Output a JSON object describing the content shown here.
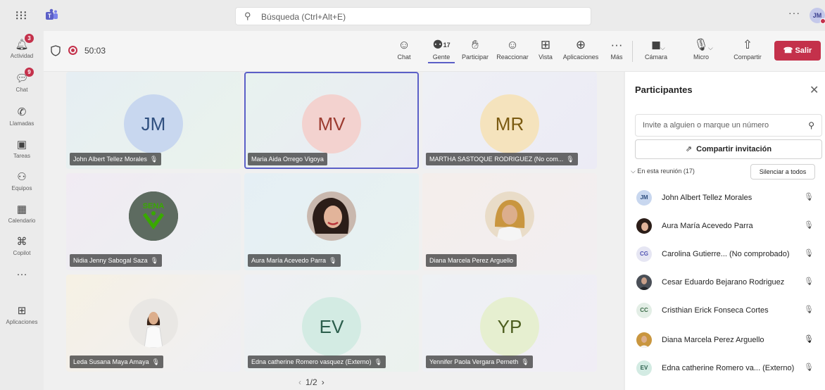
{
  "titlebar": {
    "search_placeholder": "Búsqueda (Ctrl+Alt+E)",
    "more": "···",
    "user_initials": "JM"
  },
  "rail": {
    "items": [
      {
        "label": "Actividad",
        "badge": "3"
      },
      {
        "label": "Chat",
        "badge": "9"
      },
      {
        "label": "Llamadas",
        "badge": ""
      },
      {
        "label": "Tareas",
        "badge": ""
      },
      {
        "label": "Equipos",
        "badge": ""
      },
      {
        "label": "Calendario",
        "badge": ""
      },
      {
        "label": "Copilot",
        "badge": ""
      },
      {
        "label": "···",
        "badge": ""
      },
      {
        "label": "Aplicaciones",
        "badge": ""
      }
    ]
  },
  "meeting": {
    "timer": "50:03",
    "toolbar": {
      "chat": "Chat",
      "people": "Gente",
      "people_count": "17",
      "raise": "Participar",
      "react": "Reaccionar",
      "view": "Vista",
      "apps": "Aplicaciones",
      "more": "Más",
      "camera": "Cámara",
      "mic": "Micro",
      "share": "Compartir",
      "leave": "Salir"
    }
  },
  "stage": {
    "tiles": [
      {
        "initials": "JM",
        "name": "John Albert Tellez Morales",
        "muted": true
      },
      {
        "initials": "MV",
        "name": "Maria Aida Orrego Vigoya",
        "muted": false
      },
      {
        "initials": "MR",
        "name": "MARTHA SASTOQUE RODRIGUEZ (No com...",
        "muted": true
      },
      {
        "initials": "",
        "name": "Nidia Jenny Sabogal Saza",
        "muted": true
      },
      {
        "initials": "",
        "name": "Aura María Acevedo Parra",
        "muted": true
      },
      {
        "initials": "",
        "name": "Diana Marcela Perez Arguello",
        "muted": false
      },
      {
        "initials": "",
        "name": "Leda Susana Maya Amaya",
        "muted": true
      },
      {
        "initials": "EV",
        "name": "Edna catherine Romero vasquez (Externo)",
        "muted": true
      },
      {
        "initials": "YP",
        "name": "Yennifer Paola Vergara Perneth",
        "muted": true
      }
    ],
    "pager": "1/2"
  },
  "panel": {
    "title": "Participantes",
    "invite_placeholder": "Invite a alguien o marque un número",
    "share_invite": "Compartir invitación",
    "section": "En esta reunión (17)",
    "mute_all": "Silenciar a todos",
    "participants": [
      {
        "initials": "JM",
        "name": "John Albert Tellez Morales",
        "mic": "muted"
      },
      {
        "initials": "",
        "name": "Aura María Acevedo Parra",
        "mic": "muted"
      },
      {
        "initials": "CG",
        "name": "Carolina Gutierre... (No comprobado)",
        "mic": "muted"
      },
      {
        "initials": "",
        "name": "Cesar Eduardo Bejarano Rodriguez",
        "mic": "muted"
      },
      {
        "initials": "CC",
        "name": "Cristhian Erick Fonseca Cortes",
        "mic": "muted"
      },
      {
        "initials": "",
        "name": "Diana Marcela Perez Arguello",
        "mic": "on"
      },
      {
        "initials": "EV",
        "name": "Edna catherine Romero va... (Externo)",
        "mic": "muted"
      }
    ]
  }
}
